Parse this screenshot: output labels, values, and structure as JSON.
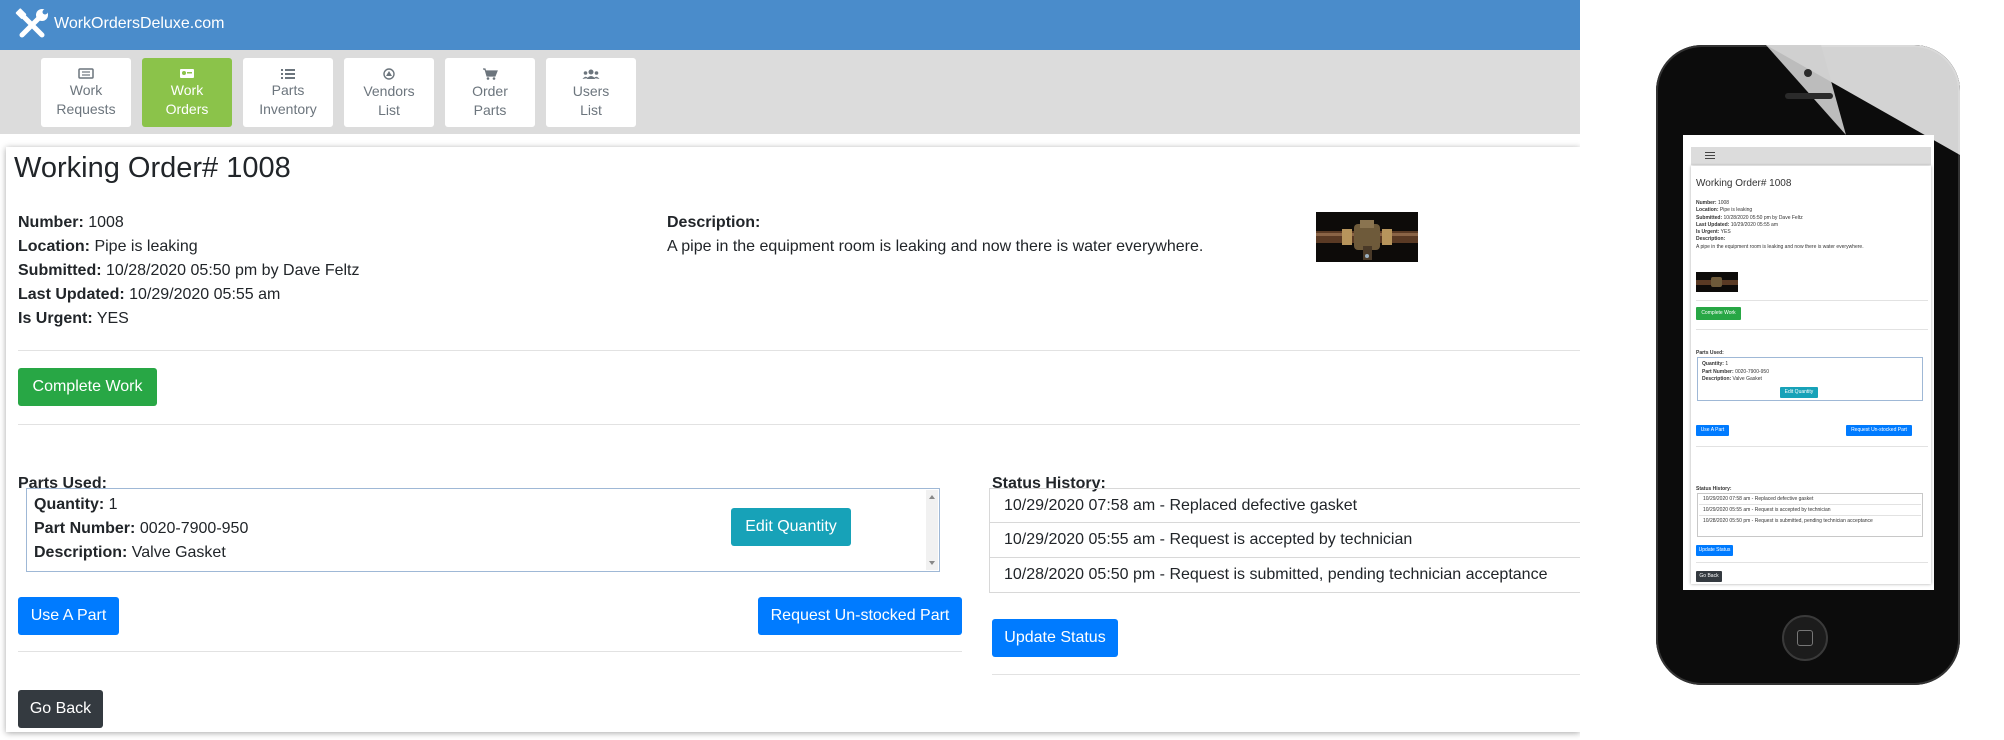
{
  "app": {
    "brand": "WorkOrdersDeluxe.com",
    "nav": [
      {
        "label": "Work\nRequests",
        "icon": "ticket-icon",
        "active": false
      },
      {
        "label": "Work\nOrders",
        "icon": "id-card-icon",
        "active": true
      },
      {
        "label": "Parts\nInventory",
        "icon": "list-icon",
        "active": false
      },
      {
        "label": "Vendors\nList",
        "icon": "vendor-icon",
        "active": false
      },
      {
        "label": "Order\nParts",
        "icon": "cart-icon",
        "active": false
      },
      {
        "label": "Users\nList",
        "icon": "users-icon",
        "active": false
      }
    ]
  },
  "order": {
    "title": "Working Order# 1008",
    "number_label": "Number:",
    "number": "1008",
    "location_label": "Location:",
    "location": "Pipe is leaking",
    "submitted_label": "Submitted:",
    "submitted": "10/28/2020 05:50 pm by Dave Feltz",
    "updated_label": "Last Updated:",
    "updated": "10/29/2020 05:55 am",
    "urgent_label": "Is Urgent:",
    "urgent": "YES",
    "description_label": "Description:",
    "description": "A pipe in the equipment room is leaking and now there is water everywhere."
  },
  "actions": {
    "complete": "Complete Work",
    "use_part": "Use A Part",
    "request_part": "Request Un-stocked Part",
    "update_status": "Update Status",
    "go_back": "Go Back",
    "edit_quantity": "Edit Quantity"
  },
  "parts": {
    "heading": "Parts Used:",
    "items": [
      {
        "quantity_label": "Quantity:",
        "quantity": "1",
        "part_label": "Part Number:",
        "part_number": "0020-7900-950",
        "desc_label": "Description:",
        "description": "Valve Gasket"
      }
    ]
  },
  "status": {
    "heading": "Status History:",
    "items": [
      "10/29/2020 07:58 am - Replaced defective gasket",
      "10/29/2020 05:55 am - Request is accepted by technician",
      "10/28/2020 05:50 pm - Request is submitted, pending technician acceptance"
    ]
  },
  "mobile": {
    "menu_icon": "hamburger-icon",
    "title": "Working Order# 1008",
    "number": "1008",
    "location": "Pipe is leaking",
    "submitted": "10/28/2020 05:50 pm by Dave Feltz",
    "updated": "10/29/2020 05:55 am",
    "urgent": "YES",
    "description": "A pipe in the equipment room is leaking and now there is water everywhere.",
    "status_items": [
      "10/29/2020 07:58 am - Replaced defective gasket",
      "10/29/2020 05:55 am - Request is accepted by technician",
      "10/28/2020 05:50 pm - Request is submitted, pending technician acceptance"
    ]
  },
  "colors": {
    "topbar": "#4a8ccb",
    "active_nav": "#8bc34a",
    "primary": "#007bff",
    "success": "#28a745",
    "info": "#17a2b8",
    "dark": "#343a40"
  }
}
